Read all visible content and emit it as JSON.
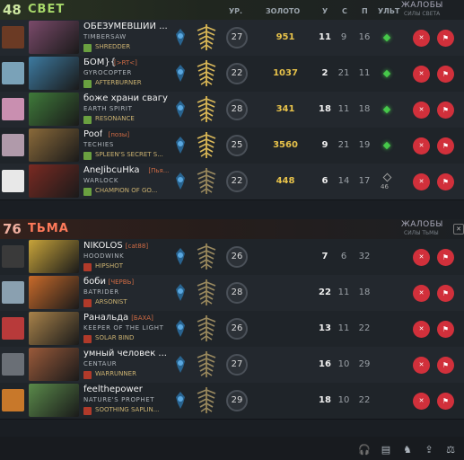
{
  "radiant": {
    "score": "48",
    "name": "СВЕТ"
  },
  "dire": {
    "score": "76",
    "name": "ТЬМА"
  },
  "columns": {
    "level": "УР.",
    "gold": "ЗОЛОТО",
    "kills": "У",
    "deaths": "С",
    "assists": "П",
    "ult": "УЛЬТ"
  },
  "reports_radiant": {
    "title": "ЖАЛОБЫ",
    "sub": "СИЛЫ СВЕТА"
  },
  "reports_dire": {
    "title": "ЖАЛОБЫ",
    "sub": "СИЛЫ ТЬМЫ"
  },
  "buttons": {
    "mute": "✕",
    "report": "⚑"
  },
  "colors": {
    "gold": "#e7c24a",
    "radiant": "#a7d86a",
    "dire": "#ff7a5a",
    "ult_ready": "#46c84a",
    "button": "#d1303b"
  },
  "players": [
    {
      "name": "ОБЕЗУМЕВШИЙ ...",
      "guild": "",
      "hero": "TIMBERSAW",
      "skill": "SHREDDER",
      "level": "27",
      "gold": "951",
      "kills": "11",
      "deaths": "9",
      "assists": "16",
      "ult": "ready",
      "hero_color": "#7a4a6a",
      "avatar_color": "#6b3a24"
    },
    {
      "name": "БОМ}{",
      "guild": "[>RT<]",
      "hero": "GYROCOPTER",
      "skill": "AFTERBURNER",
      "level": "22",
      "gold": "1037",
      "kills": "2",
      "deaths": "21",
      "assists": "11",
      "ult": "ready",
      "hero_color": "#3d7aa0",
      "avatar_color": "#7aa2b8"
    },
    {
      "name": "боже храни свагу",
      "guild": "",
      "hero": "EARTH SPIRIT",
      "skill": "RESONANCE",
      "level": "28",
      "gold": "341",
      "kills": "18",
      "deaths": "11",
      "assists": "18",
      "ult": "ready",
      "hero_color": "#3f7a3a",
      "avatar_color": "#c98fb0"
    },
    {
      "name": "Poof",
      "guild": "[позы]",
      "hero": "TECHIES",
      "skill": "SPLEEN'S SECRET S...",
      "level": "25",
      "gold": "3560",
      "kills": "9",
      "deaths": "21",
      "assists": "19",
      "ult": "ready",
      "hero_color": "#8a6a3a",
      "avatar_color": "#b09aaa"
    },
    {
      "name": "AneJibcuHka",
      "guild": "[Пья...",
      "hero": "WARLOCK",
      "skill": "CHAMPION OF GO...",
      "level": "22",
      "gold": "448",
      "kills": "6",
      "deaths": "14",
      "assists": "17",
      "ult": "46",
      "hero_color": "#7a2a22",
      "avatar_color": "#e8e8e8"
    },
    {
      "name": "NIKOLOS",
      "guild": "[cat88]",
      "hero": "HOODWINK",
      "skill": "HIPSHOT",
      "level": "26",
      "gold": "",
      "kills": "7",
      "deaths": "6",
      "assists": "32",
      "ult": "",
      "hero_color": "#c8a43a",
      "avatar_color": "#3a3a3a"
    },
    {
      "name": "боби",
      "guild": "[ЧЕРВЬ]",
      "hero": "BATRIDER",
      "skill": "ARSONIST",
      "level": "28",
      "gold": "",
      "kills": "22",
      "deaths": "11",
      "assists": "18",
      "ult": "",
      "hero_color": "#c86a2a",
      "avatar_color": "#8aa0b0"
    },
    {
      "name": "Ранальда",
      "guild": "[БАХА]",
      "hero": "KEEPER OF THE LIGHT",
      "skill": "SOLAR BIND",
      "level": "26",
      "gold": "",
      "kills": "13",
      "deaths": "11",
      "assists": "22",
      "ult": "",
      "hero_color": "#a8824a",
      "avatar_color": "#b83a3a"
    },
    {
      "name": "умный человек ...",
      "guild": "",
      "hero": "CENTAUR",
      "skill": "WARRUNNER",
      "level": "27",
      "gold": "",
      "kills": "16",
      "deaths": "10",
      "assists": "29",
      "ult": "",
      "hero_color": "#9a5a3a",
      "avatar_color": "#6a6f76"
    },
    {
      "name": "feelthepower",
      "guild": "",
      "hero": "NATURE'S PROPHET",
      "skill": "SOOTHING SAPLIN...",
      "level": "29",
      "gold": "",
      "kills": "18",
      "deaths": "10",
      "assists": "22",
      "ult": "",
      "hero_color": "#5a8a4a",
      "avatar_color": "#c8782a"
    }
  ],
  "footer_icons": [
    "headset-icon",
    "scoreboard-icon",
    "courier-icon",
    "share-icon",
    "scale-icon"
  ]
}
